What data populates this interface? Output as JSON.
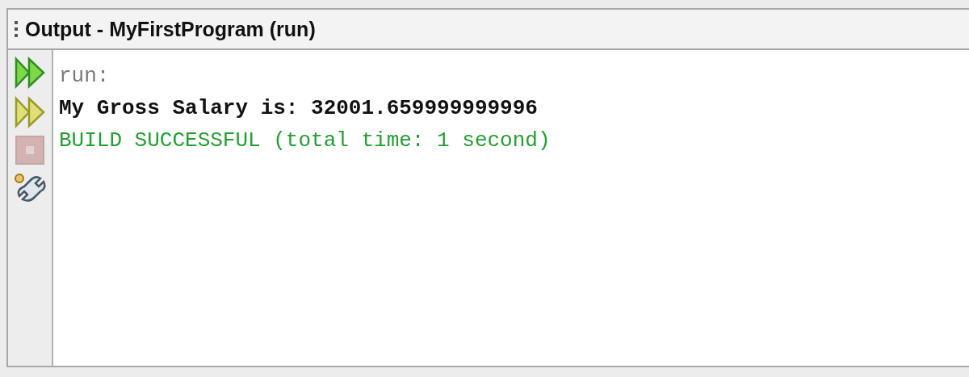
{
  "panel": {
    "title": "Output - MyFirstProgram (run)"
  },
  "toolbar": [
    {
      "kind": "rerun",
      "disabled": false
    },
    {
      "kind": "rerun-params",
      "disabled": false
    },
    {
      "kind": "stop",
      "disabled": true
    },
    {
      "kind": "settings",
      "disabled": false
    }
  ],
  "output_lines": [
    {
      "kind": "info",
      "text": "run:"
    },
    {
      "kind": "plain",
      "text": "My Gross Salary is: 32001.659999999996"
    },
    {
      "kind": "success",
      "text": "BUILD SUCCESSFUL (total time: 1 second)"
    }
  ]
}
